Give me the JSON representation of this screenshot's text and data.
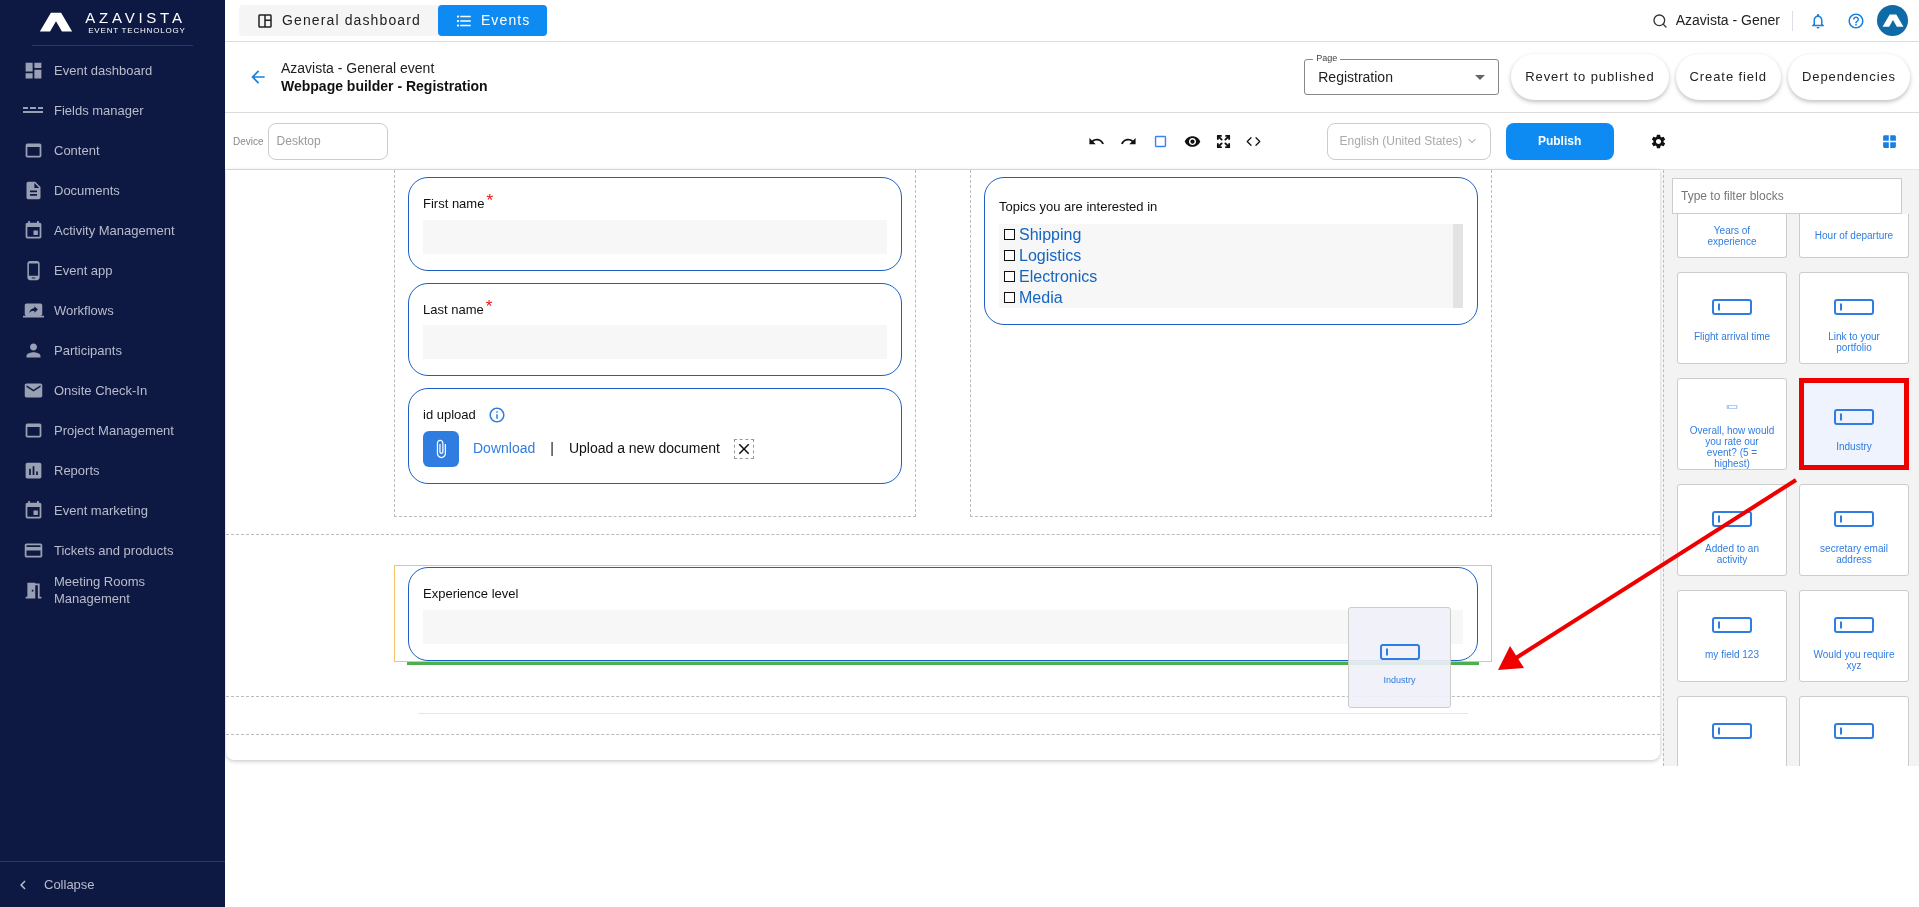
{
  "logo": {
    "name": "AZAVISTA",
    "tagline": "EVENT TECHNOLOGY"
  },
  "sidebar": {
    "items": [
      {
        "label": "Event dashboard"
      },
      {
        "label": "Fields manager"
      },
      {
        "label": "Content"
      },
      {
        "label": "Documents"
      },
      {
        "label": "Activity Management"
      },
      {
        "label": "Event app"
      },
      {
        "label": "Workflows"
      },
      {
        "label": "Participants"
      },
      {
        "label": "Onsite Check-In"
      },
      {
        "label": "Project Management"
      },
      {
        "label": "Reports"
      },
      {
        "label": "Event marketing"
      },
      {
        "label": "Tickets and products"
      },
      {
        "label": "Meeting Rooms Management"
      }
    ],
    "collapse": "Collapse"
  },
  "top_tabs": [
    {
      "label": "General dashboard",
      "selected": false
    },
    {
      "label": "Events",
      "selected": true
    }
  ],
  "top_search": "Azavista - Gener",
  "header": {
    "event": "Azavista - General event",
    "title": "Webpage builder - Registration",
    "page_select": {
      "label": "Page",
      "value": "Registration"
    },
    "buttons": [
      "Revert to published",
      "Create field",
      "Dependencies"
    ]
  },
  "toolbar": {
    "device_label": "Device",
    "device_placeholder": "Desktop",
    "language": "English (United States)",
    "publish": "Publish"
  },
  "required_mark": "*",
  "form": {
    "left": [
      {
        "kind": "text",
        "label": "First name",
        "required": true
      },
      {
        "kind": "text",
        "label": "Last name",
        "required": true
      },
      {
        "kind": "upload",
        "label": "id upload",
        "link": "Download",
        "separator": "|",
        "action": "Upload a new document"
      }
    ],
    "right": [
      {
        "kind": "checklist",
        "label": "Topics you are interested in",
        "options": [
          {
            "label": "Shipping",
            "checked": false
          },
          {
            "label": "Logistics",
            "checked": false
          },
          {
            "label": "Electronics",
            "checked": false
          },
          {
            "label": "Media",
            "checked": false
          }
        ]
      }
    ],
    "full": [
      {
        "kind": "text",
        "label": "Experience level",
        "required": false
      }
    ]
  },
  "drag_ghost": {
    "label": "Industry"
  },
  "blocks": {
    "placeholder": "Type to filter blocks",
    "items": [
      {
        "label": "Years of experience",
        "selected": false
      },
      {
        "label": "Hour of departure",
        "selected": false
      },
      {
        "label": "Flight arrival time",
        "selected": false
      },
      {
        "label": "Link to your portfolio",
        "selected": false
      },
      {
        "label": "Overall, how would you rate our event? (5 = highest)",
        "selected": false
      },
      {
        "label": "Industry",
        "selected": true
      },
      {
        "label": "Added to an activity",
        "selected": false
      },
      {
        "label": "secretary email address",
        "selected": false
      },
      {
        "label": "my field 123",
        "selected": false
      },
      {
        "label": "Would you require xyz",
        "selected": false
      },
      {
        "selected": false
      },
      {
        "selected": false
      }
    ]
  }
}
